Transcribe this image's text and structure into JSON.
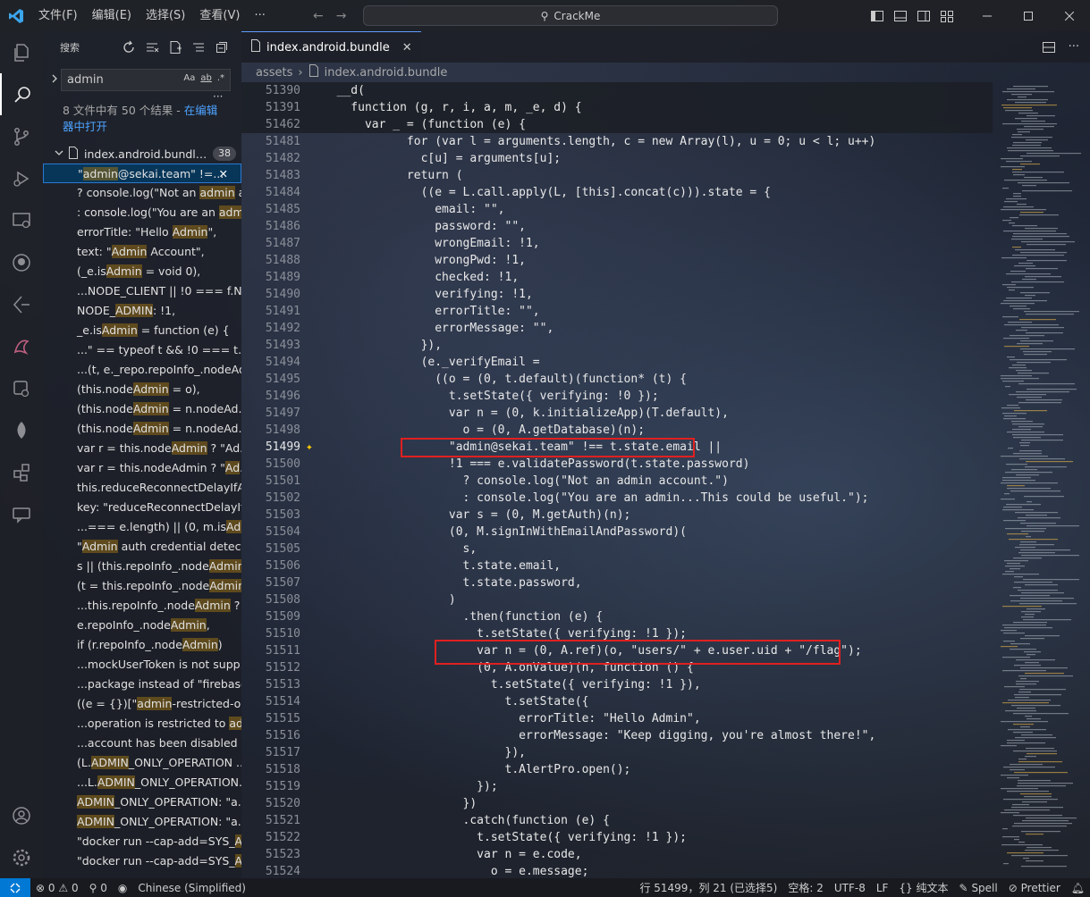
{
  "titlebar": {
    "menus": [
      "文件(F)",
      "编辑(E)",
      "选择(S)",
      "查看(V)"
    ],
    "more": "···",
    "search_text": "CrackMe"
  },
  "sidebar": {
    "title": "搜索",
    "search_value": "admin",
    "opt_case": "Aa",
    "opt_word": "ab",
    "opt_regex": ".*",
    "more": "···",
    "result_summary": "8 文件中有 50 个结果 - ",
    "result_link_1": "在编辑",
    "result_link_2": "器中打开",
    "file_name": "index.android.bundle",
    "file_name_display": "index.android.bundle...",
    "file_count": "38",
    "matches": [
      {
        "pre": "\"",
        "hl": "admin",
        "post": "@sekai.team\" !=..."
      },
      {
        "pre": "? console.log(\"Not an ",
        "hl": "admin",
        "post": " a..."
      },
      {
        "pre": ": console.log(\"You are an ",
        "hl": "admi",
        "post": "..."
      },
      {
        "pre": "errorTitle: \"Hello ",
        "hl": "Admin",
        "post": "\","
      },
      {
        "pre": "text: \"",
        "hl": "Admin",
        "post": " Account\","
      },
      {
        "pre": "(_e.is",
        "hl": "Admin",
        "post": " = void 0),"
      },
      {
        "pre": "...NODE_CLIENT || !0 === f.N...",
        "hl": "",
        "post": ""
      },
      {
        "pre": "NODE_",
        "hl": "ADMIN",
        "post": ": !1,"
      },
      {
        "pre": "_e.is",
        "hl": "Admin",
        "post": " = function (e) {"
      },
      {
        "pre": "...\" == typeof t && !0 === t.a...",
        "hl": "",
        "post": ""
      },
      {
        "pre": "...(t, e._repo.repoInfo_.nodeAd...",
        "hl": "",
        "post": ""
      },
      {
        "pre": "(this.node",
        "hl": "Admin",
        "post": " = o),"
      },
      {
        "pre": "(this.node",
        "hl": "Admin",
        "post": " = n.nodeAd..."
      },
      {
        "pre": "(this.node",
        "hl": "Admin",
        "post": " = n.nodeAd..."
      },
      {
        "pre": "var r = this.node",
        "hl": "Admin",
        "post": " ? \"Ad..."
      },
      {
        "pre": "var r = this.nodeAdmin ? \"",
        "hl": "Ad",
        "post": "..."
      },
      {
        "pre": "this.reduceReconnectDelayIfA...",
        "hl": "",
        "post": ""
      },
      {
        "pre": "key: \"reduceReconnectDelayIf...",
        "hl": "",
        "post": ""
      },
      {
        "pre": "...=== e.length) || (0, m.is",
        "hl": "Adm",
        "post": "..."
      },
      {
        "pre": "\"",
        "hl": "Admin",
        "post": " auth credential detect..."
      },
      {
        "pre": "s || (this.repoInfo_.node",
        "hl": "Admin",
        "post": "..."
      },
      {
        "pre": "(t = this.repoInfo_.node",
        "hl": "Admin",
        "post": "..."
      },
      {
        "pre": "...this.repoInfo_.node",
        "hl": "Admin",
        "post": " ? ..."
      },
      {
        "pre": "e.repoInfo_.node",
        "hl": "Admin",
        "post": ","
      },
      {
        "pre": "if (r.repoInfo_.node",
        "hl": "Admin",
        "post": ")"
      },
      {
        "pre": "...mockUserToken is not supp...",
        "hl": "",
        "post": ""
      },
      {
        "pre": "...package instead of \"firebase...",
        "hl": "",
        "post": ""
      },
      {
        "pre": "((e = {})[\"",
        "hl": "admin",
        "post": "-restricted-op..."
      },
      {
        "pre": "...operation is restricted to ",
        "hl": "ad",
        "post": "..."
      },
      {
        "pre": "...account has been disabled b...",
        "hl": "",
        "post": ""
      },
      {
        "pre": "(L.",
        "hl": "ADMIN",
        "post": "_ONLY_OPERATION ..."
      },
      {
        "pre": "...L.",
        "hl": "ADMIN",
        "post": "_ONLY_OPERATION..."
      },
      {
        "pre": "",
        "hl": "ADMIN",
        "post": "_ONLY_OPERATION: \"a..."
      },
      {
        "pre": "",
        "hl": "ADMIN",
        "post": "_ONLY_OPERATION: \"a..."
      },
      {
        "pre": "\"docker run --cap-add=SYS_",
        "hl": "A",
        "post": "..."
      },
      {
        "pre": "\"docker run --cap-add=SYS_",
        "hl": "A",
        "post": "..."
      }
    ]
  },
  "editor": {
    "tab_label": "index.android.bundle",
    "breadcrumb_folder": "assets",
    "breadcrumb_file": "index.android.bundle",
    "lines": [
      {
        "n": "51390",
        "t": "  __d(",
        "sticky": true
      },
      {
        "n": "51391",
        "t": "    function (g, r, i, a, m, _e, d) {",
        "sticky": true
      },
      {
        "n": "51462",
        "t": "      var _ = (function (e) {",
        "sticky": true
      },
      {
        "n": "51481",
        "t": "            for (var l = arguments.length, c = new Array(l), u = 0; u < l; u++)"
      },
      {
        "n": "51482",
        "t": "              c[u] = arguments[u];"
      },
      {
        "n": "51483",
        "t": "            return ("
      },
      {
        "n": "51484",
        "t": "              ((e = L.call.apply(L, [this].concat(c))).state = {"
      },
      {
        "n": "51485",
        "t": "                email: \"\","
      },
      {
        "n": "51486",
        "t": "                password: \"\","
      },
      {
        "n": "51487",
        "t": "                wrongEmail: !1,"
      },
      {
        "n": "51488",
        "t": "                wrongPwd: !1,"
      },
      {
        "n": "51489",
        "t": "                checked: !1,"
      },
      {
        "n": "51490",
        "t": "                verifying: !1,"
      },
      {
        "n": "51491",
        "t": "                errorTitle: \"\","
      },
      {
        "n": "51492",
        "t": "                errorMessage: \"\","
      },
      {
        "n": "51493",
        "t": "              }),"
      },
      {
        "n": "51494",
        "t": "              (e._verifyEmail ="
      },
      {
        "n": "51495",
        "t": "                ((o = (0, t.default)(function* (t) {"
      },
      {
        "n": "51496",
        "t": "                  t.setState({ verifying: !0 });"
      },
      {
        "n": "51497",
        "t": "                  var n = (0, k.initializeApp)(T.default),"
      },
      {
        "n": "51498",
        "t": "                    o = (0, A.getDatabase)(n);"
      },
      {
        "n": "51499",
        "t": "                  \"admin@sekai.team\" !== t.state.email ||",
        "current": true
      },
      {
        "n": "51500",
        "t": "                  !1 === e.validatePassword(t.state.password)"
      },
      {
        "n": "51501",
        "t": "                    ? console.log(\"Not an admin account.\")"
      },
      {
        "n": "51502",
        "t": "                    : console.log(\"You are an admin...This could be useful.\");"
      },
      {
        "n": "51503",
        "t": "                  var s = (0, M.getAuth)(n);"
      },
      {
        "n": "51504",
        "t": "                  (0, M.signInWithEmailAndPassword)("
      },
      {
        "n": "51505",
        "t": "                    s,"
      },
      {
        "n": "51506",
        "t": "                    t.state.email,"
      },
      {
        "n": "51507",
        "t": "                    t.state.password,"
      },
      {
        "n": "51508",
        "t": "                  )"
      },
      {
        "n": "51509",
        "t": "                    .then(function (e) {"
      },
      {
        "n": "51510",
        "t": "                      t.setState({ verifying: !1 });"
      },
      {
        "n": "51511",
        "t": "                      var n = (0, A.ref)(o, \"users/\" + e.user.uid + \"/flag\");"
      },
      {
        "n": "51512",
        "t": "                      (0, A.onValue)(n, function () {"
      },
      {
        "n": "51513",
        "t": "                        t.setState({ verifying: !1 }),"
      },
      {
        "n": "51514",
        "t": "                          t.setState({"
      },
      {
        "n": "51515",
        "t": "                            errorTitle: \"Hello Admin\","
      },
      {
        "n": "51516",
        "t": "                            errorMessage: \"Keep digging, you're almost there!\","
      },
      {
        "n": "51517",
        "t": "                          }),"
      },
      {
        "n": "51518",
        "t": "                          t.AlertPro.open();"
      },
      {
        "n": "51519",
        "t": "                      });"
      },
      {
        "n": "51520",
        "t": "                    })"
      },
      {
        "n": "51521",
        "t": "                    .catch(function (e) {"
      },
      {
        "n": "51522",
        "t": "                      t.setState({ verifying: !1 });"
      },
      {
        "n": "51523",
        "t": "                      var n = e.code,"
      },
      {
        "n": "51524",
        "t": "                        o = e.message;"
      }
    ]
  },
  "statusbar": {
    "errors": "0",
    "warnings": "0",
    "ports": "0",
    "language_pack": "Chinese (Simplified)",
    "position": "行 51499，列 21 (已选择5)",
    "indent": "空格: 2",
    "encoding": "UTF-8",
    "eol": "LF",
    "language": "纯文本",
    "spell": "Spell",
    "prettier": "Prettier"
  }
}
